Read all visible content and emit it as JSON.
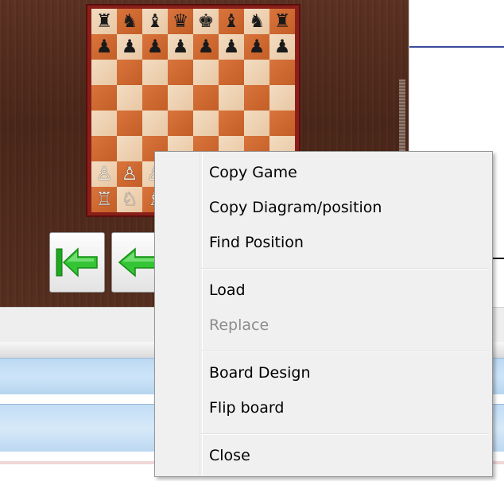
{
  "board": {
    "ranks": [
      [
        "♜",
        "♞",
        "♝",
        "♛",
        "♚",
        "♝",
        "♞",
        "♜"
      ],
      [
        "♟",
        "♟",
        "♟",
        "♟",
        "♟",
        "♟",
        "♟",
        "♟"
      ],
      [
        "",
        "",
        "",
        "",
        "",
        "",
        "",
        ""
      ],
      [
        "",
        "",
        "",
        "",
        "",
        "",
        "",
        ""
      ],
      [
        "",
        "",
        "",
        "",
        "",
        "",
        "",
        ""
      ],
      [
        "",
        "",
        "",
        "",
        "",
        "",
        "",
        ""
      ],
      [
        "♙",
        "♙",
        "♙",
        "♙",
        "♙",
        "♙",
        "♙",
        "♙"
      ],
      [
        "♖",
        "♘",
        "♗",
        "♕",
        "♔",
        "♗",
        "♘",
        "♖"
      ]
    ],
    "light_color": "#ecd2b3",
    "dark_color": "#cf6a32"
  },
  "nav": {
    "buttons": [
      {
        "name": "first-move-button",
        "icon": "arrow-left-bar-icon"
      },
      {
        "name": "previous-move-button",
        "icon": "arrow-left-icon"
      }
    ],
    "arrow_color": "#2fbd2f"
  },
  "context_menu": {
    "groups": [
      [
        {
          "label": "Copy Game",
          "enabled": true
        },
        {
          "label": "Copy Diagram/position",
          "enabled": true
        },
        {
          "label": "Find Position",
          "enabled": true
        }
      ],
      [
        {
          "label": "Load",
          "enabled": true
        },
        {
          "label": "Replace",
          "enabled": false
        }
      ],
      [
        {
          "label": "Board Design",
          "enabled": true
        },
        {
          "label": "Flip board",
          "enabled": true
        }
      ],
      [
        {
          "label": "Close",
          "enabled": true
        }
      ]
    ]
  }
}
